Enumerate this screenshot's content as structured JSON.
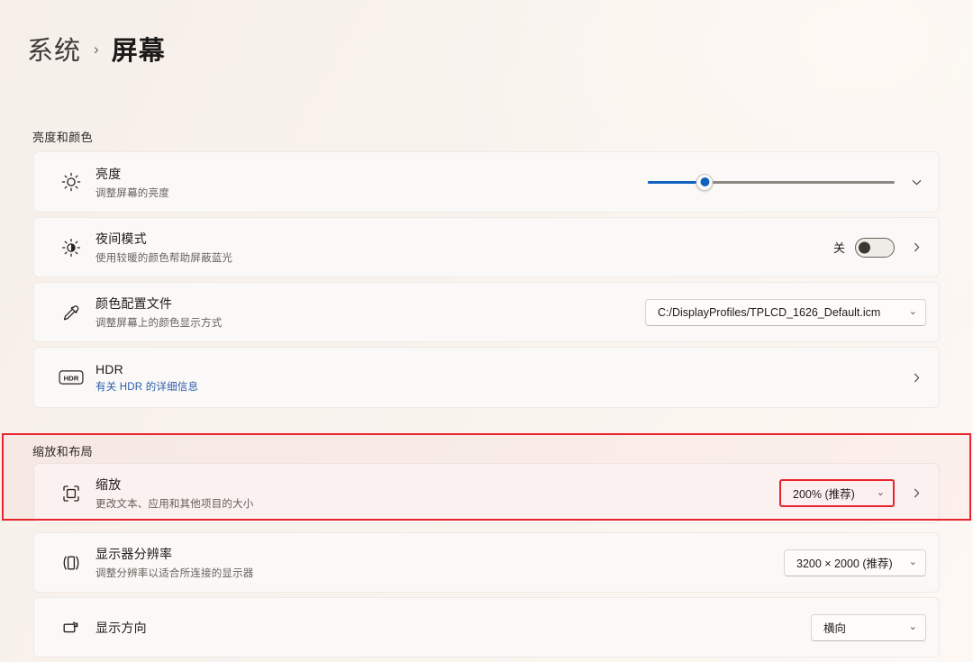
{
  "breadcrumb": {
    "parent": "系统",
    "separator": "›",
    "current": "屏幕"
  },
  "colors": {
    "accent_blue": "#1061c0",
    "highlight_red": "#e8252b",
    "link_blue": "#2a5dad",
    "card_bg": "#fbf9f7",
    "page_bg": "#f7f1ec"
  },
  "sections": [
    {
      "label": "亮度和颜色",
      "rows": [
        {
          "icon": "brightness-sun-icon",
          "title": "亮度",
          "subtitle": "调整屏幕的亮度",
          "control": "slider",
          "slider_percent": 23,
          "expander": "chevron-down-icon"
        },
        {
          "icon": "night-light-icon",
          "title": "夜间模式",
          "subtitle": "使用较暖的颜色帮助屏蔽蓝光",
          "control": "toggle",
          "toggle_label": "关",
          "toggle_on": false,
          "expander": "chevron-right-icon"
        },
        {
          "icon": "color-profile-eyedropper-icon",
          "title": "颜色配置文件",
          "subtitle": "调整屏幕上的颜色显示方式",
          "control": "combo",
          "combo_value": "C:/DisplayProfiles/TPLCD_1626_Default.icm",
          "caret": "⌄"
        },
        {
          "icon": "hdr-badge-icon",
          "title": "HDR",
          "subtitle": "有关 HDR 的详细信息",
          "subtitle_is_link": true,
          "control": "none",
          "expander": "chevron-right-icon"
        }
      ]
    },
    {
      "label": "缩放和布局",
      "highlighted": true,
      "rows": [
        {
          "icon": "scale-icon",
          "title": "缩放",
          "subtitle": "更改文本、应用和其他项目的大小",
          "control": "combo",
          "combo_value": "200% (推荐)",
          "caret": "⌄",
          "combo_highlighted": true,
          "expander": "chevron-right-icon"
        },
        {
          "icon": "display-resolution-icon",
          "title": "显示器分辨率",
          "subtitle": "调整分辨率以适合所连接的显示器",
          "control": "combo",
          "combo_value": "3200 × 2000 (推荐)",
          "caret": "⌄"
        },
        {
          "icon": "display-orientation-icon",
          "title": "显示方向",
          "subtitle": "",
          "control": "combo",
          "combo_value": "横向",
          "caret": "⌄"
        }
      ]
    }
  ]
}
